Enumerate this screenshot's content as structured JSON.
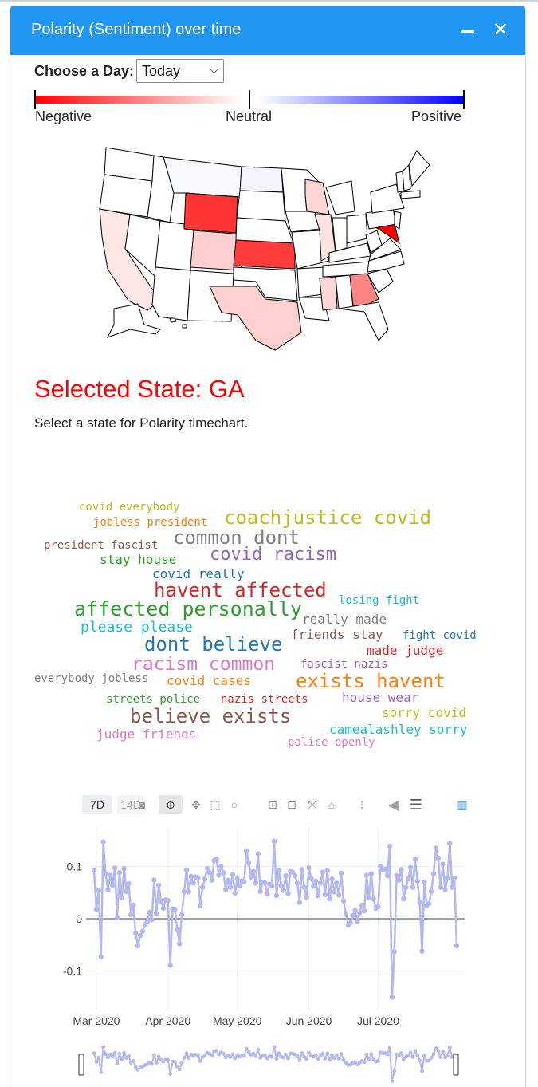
{
  "window": {
    "title": "Polarity (Sentiment) over time",
    "minimize_icon": "minus-icon",
    "close_icon": "close-icon"
  },
  "controls": {
    "day_label": "Choose a Day:",
    "day_selected": "Today"
  },
  "legend": {
    "negative": "Negative",
    "neutral": "Neutral",
    "positive": "Positive",
    "colors": {
      "negative": "#ff0000",
      "neutral": "#ffffff",
      "positive": "#0000ff"
    }
  },
  "selected_state": {
    "title": "Selected State: GA",
    "hint": "Select a state for Polarity timechart."
  },
  "word_cloud": [
    {
      "text": "covid everybody",
      "color": "#bcbd22"
    },
    {
      "text": "jobless president",
      "color": "#ff7f0e"
    },
    {
      "text": "coachjustice covid",
      "color": "#bcbd22"
    },
    {
      "text": "common dont",
      "color": "#7f7f7f"
    },
    {
      "text": "president fascist",
      "color": "#8c564b"
    },
    {
      "text": "stay house",
      "color": "#2ca02c"
    },
    {
      "text": "covid racism",
      "color": "#9467bd"
    },
    {
      "text": "covid really",
      "color": "#1f77b4"
    },
    {
      "text": "havent affected",
      "color": "#d62728"
    },
    {
      "text": "losing fight",
      "color": "#17becf"
    },
    {
      "text": "affected personally",
      "color": "#2ca02c"
    },
    {
      "text": "really made",
      "color": "#7f7f7f"
    },
    {
      "text": "please please",
      "color": "#17becf"
    },
    {
      "text": "friends stay",
      "color": "#8c564b"
    },
    {
      "text": "fight covid",
      "color": "#1f77b4"
    },
    {
      "text": "dont believe",
      "color": "#1f77b4"
    },
    {
      "text": "made judge",
      "color": "#d62728"
    },
    {
      "text": "racism common",
      "color": "#e377c2"
    },
    {
      "text": "fascist nazis",
      "color": "#9467bd"
    },
    {
      "text": "everybody jobless",
      "color": "#7f7f7f"
    },
    {
      "text": "covid cases",
      "color": "#ff7f0e"
    },
    {
      "text": "exists havent",
      "color": "#ff7f0e"
    },
    {
      "text": "streets police",
      "color": "#2ca02c"
    },
    {
      "text": "nazis streets",
      "color": "#d62728"
    },
    {
      "text": "house wear",
      "color": "#9467bd"
    },
    {
      "text": "believe exists",
      "color": "#8c564b"
    },
    {
      "text": "sorry covid",
      "color": "#bcbd22"
    },
    {
      "text": "judge friends",
      "color": "#e377c2"
    },
    {
      "text": "camealashley sorry",
      "color": "#17becf"
    },
    {
      "text": "police openly",
      "color": "#e377c2"
    }
  ],
  "chart_toolbar": {
    "range_buttons": [
      "7D",
      "14D"
    ],
    "icons": [
      "camera-icon",
      "zoom-icon",
      "pan-icon",
      "box-select-icon",
      "lasso-icon",
      "zoom-in-icon",
      "zoom-out-icon",
      "autoscale-icon",
      "reset-axes-icon",
      "spike-lines-icon",
      "hover-closest-icon",
      "hover-compare-icon",
      "plotly-logo-icon"
    ]
  },
  "chart_data": {
    "type": "line",
    "series_color": "#b3b8f0",
    "ylim": [
      -0.16,
      0.16
    ],
    "yticks": [
      0.1,
      0,
      -0.1
    ],
    "ytick_labels": [
      "0.1",
      "0",
      "-0.1"
    ],
    "xticks": [
      "2020-03-01",
      "2020-04-01",
      "2020-05-01",
      "2020-06-01",
      "2020-07-01"
    ],
    "xtick_labels": [
      "Mar 2020",
      "Apr 2020",
      "May 2020",
      "Jun 2020",
      "Jul 2020"
    ],
    "x_start": "2020-02-29",
    "values": [
      0.093,
      0.018,
      0.054,
      -0.073,
      0.147,
      0.086,
      0.055,
      0.083,
      0.064,
      0.097,
      0.002,
      0.088,
      0.04,
      0.096,
      0.052,
      0.067,
      0.008,
      0.026,
      -0.028,
      -0.052,
      -0.032,
      -0.024,
      -0.011,
      -0.006,
      0.012,
      -0.002,
      0.074,
      0.01,
      0.064,
      0.034,
      0.02,
      0.036,
      0.035,
      -0.089,
      0.019,
      0.018,
      -0.021,
      -0.048,
      0.008,
      0.052,
      0.093,
      0.051,
      0.081,
      0.068,
      0.08,
      0.078,
      0.025,
      0.06,
      0.076,
      0.096,
      0.088,
      0.074,
      0.111,
      0.114,
      0.083,
      0.1,
      0.088,
      0.056,
      0.073,
      0.06,
      0.084,
      0.049,
      0.076,
      0.062,
      0.072,
      0.071,
      0.13,
      0.106,
      0.08,
      0.09,
      0.068,
      0.124,
      0.052,
      0.07,
      0.068,
      0.047,
      0.066,
      0.063,
      0.148,
      0.044,
      0.092,
      0.063,
      0.054,
      0.082,
      0.048,
      0.09,
      0.089,
      0.082,
      0.068,
      0.031,
      0.094,
      0.06,
      0.041,
      0.097,
      0.077,
      0.062,
      0.072,
      0.044,
      0.068,
      0.089,
      0.046,
      0.092,
      0.038,
      0.076,
      0.051,
      0.068,
      0.045,
      0.087,
      0.034,
      0.01,
      -0.012,
      -0.008,
      0.006,
      0.016,
      -0.005,
      0.011,
      0.026,
      0.015,
      0.083,
      0.04,
      0.086,
      0.038,
      0.02,
      0.023,
      0.1,
      0.093,
      0.095,
      0.082,
      0.139,
      -0.15,
      -0.063,
      0.082,
      0.074,
      0.094,
      0.038,
      0.06,
      0.076,
      0.098,
      0.06,
      0.114,
      0.072,
      0.031,
      -0.062,
      0.07,
      0.025,
      0.029,
      0.052,
      0.086,
      0.135,
      0.116,
      0.06,
      0.104,
      0.056,
      0.077,
      0.144,
      0.06,
      0.078,
      -0.052
    ]
  }
}
